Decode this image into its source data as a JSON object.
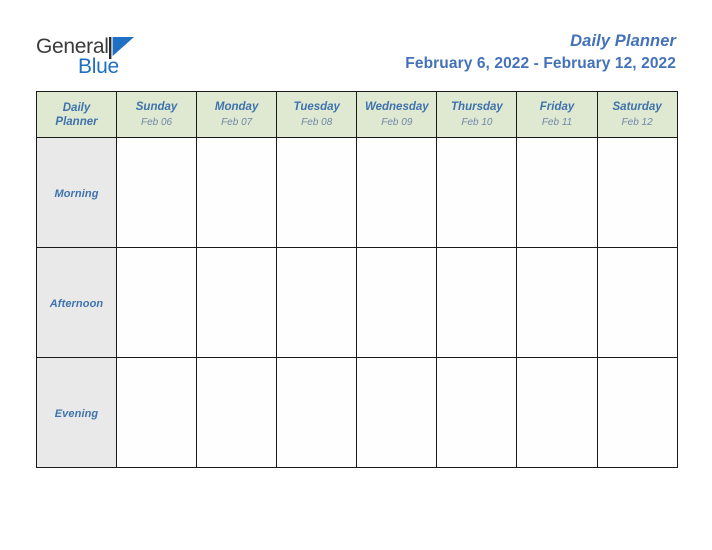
{
  "brand": {
    "name_part1": "General",
    "name_part2": "Blue",
    "flag_icon": "blue-triangle-flag-icon",
    "flag_color": "#1f6fc4"
  },
  "header": {
    "title": "Daily Planner",
    "date_range": "February 6, 2022 - February 12, 2022",
    "title_color": "#4472b8"
  },
  "table": {
    "corner_label_line1": "Daily",
    "corner_label_line2": "Planner",
    "header_bg": "#dfe8d1",
    "row_label_bg": "#e9e9e9",
    "day_name_color": "#3f73ad",
    "day_date_color": "#6f88a9",
    "columns": [
      {
        "day": "Sunday",
        "date": "Feb 06"
      },
      {
        "day": "Monday",
        "date": "Feb 07"
      },
      {
        "day": "Tuesday",
        "date": "Feb 08"
      },
      {
        "day": "Wednesday",
        "date": "Feb 09"
      },
      {
        "day": "Thursday",
        "date": "Feb 10"
      },
      {
        "day": "Friday",
        "date": "Feb 11"
      },
      {
        "day": "Saturday",
        "date": "Feb 12"
      }
    ],
    "rows": [
      {
        "label": "Morning",
        "cells": [
          "",
          "",
          "",
          "",
          "",
          "",
          ""
        ]
      },
      {
        "label": "Afternoon",
        "cells": [
          "",
          "",
          "",
          "",
          "",
          "",
          ""
        ]
      },
      {
        "label": "Evening",
        "cells": [
          "",
          "",
          "",
          "",
          "",
          "",
          ""
        ]
      }
    ]
  }
}
